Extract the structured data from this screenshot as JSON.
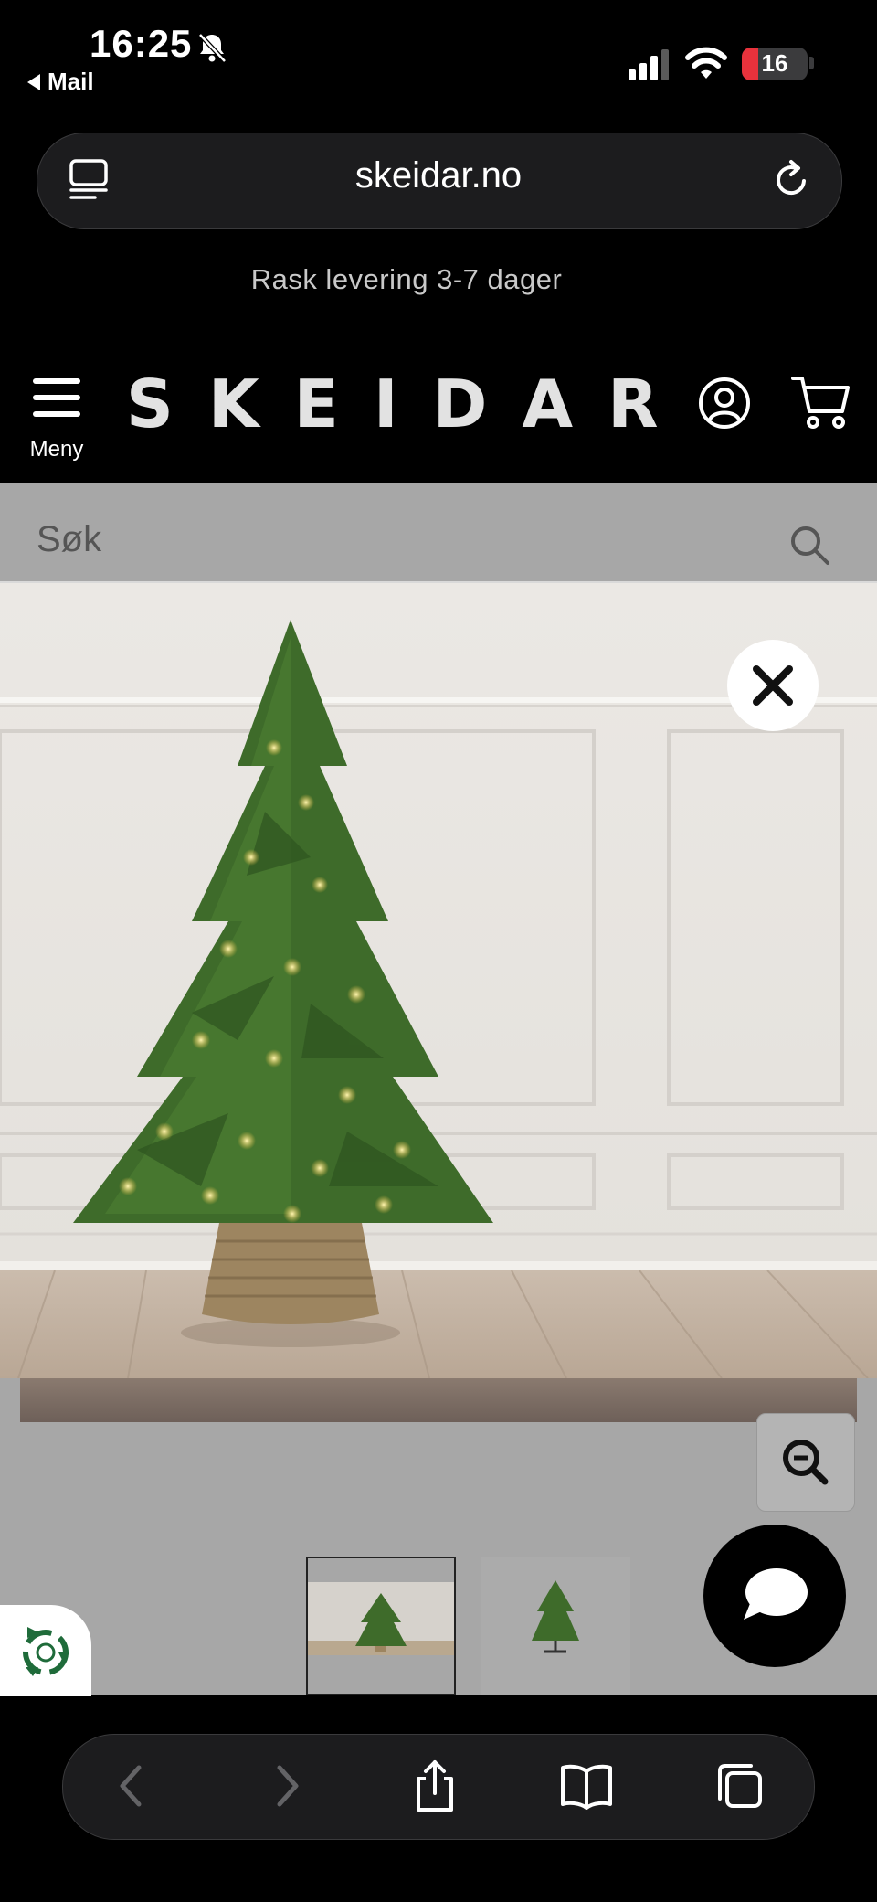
{
  "status_bar": {
    "time": "16:25",
    "back_app": "Mail",
    "battery": "16",
    "icons": [
      "bell-slash-icon",
      "signal-icon",
      "wifi-icon",
      "battery-icon"
    ]
  },
  "browser": {
    "url": "skeidar.no",
    "icons": [
      "reader-icon",
      "reload-icon"
    ]
  },
  "promo": {
    "text": "Rask levering 3-7 dager"
  },
  "header": {
    "menu_label": "Meny",
    "logo": "SKEIDAR",
    "icons": [
      "account-icon",
      "cart-icon"
    ]
  },
  "search": {
    "placeholder": "Søk"
  },
  "gallery": {
    "main_image": "christmas-tree-with-lights-in-basket",
    "thumbnails": [
      "tree-in-room-thumbnail",
      "tree-on-stand-thumbnail"
    ],
    "selected_thumbnail": 1,
    "buttons": [
      "close-button",
      "zoom-out-button",
      "chat-button",
      "recycle-button"
    ]
  },
  "toolbar": {
    "items": [
      "back-icon",
      "forward-icon",
      "share-icon",
      "bookmarks-icon",
      "tabs-icon"
    ]
  },
  "colors": {
    "page_bg": "#000000",
    "overlay": "#a7a7a7",
    "battery_low": "#e8323c",
    "recycle_green": "#1f6b3a",
    "tree_green": "#3e6b2a"
  }
}
